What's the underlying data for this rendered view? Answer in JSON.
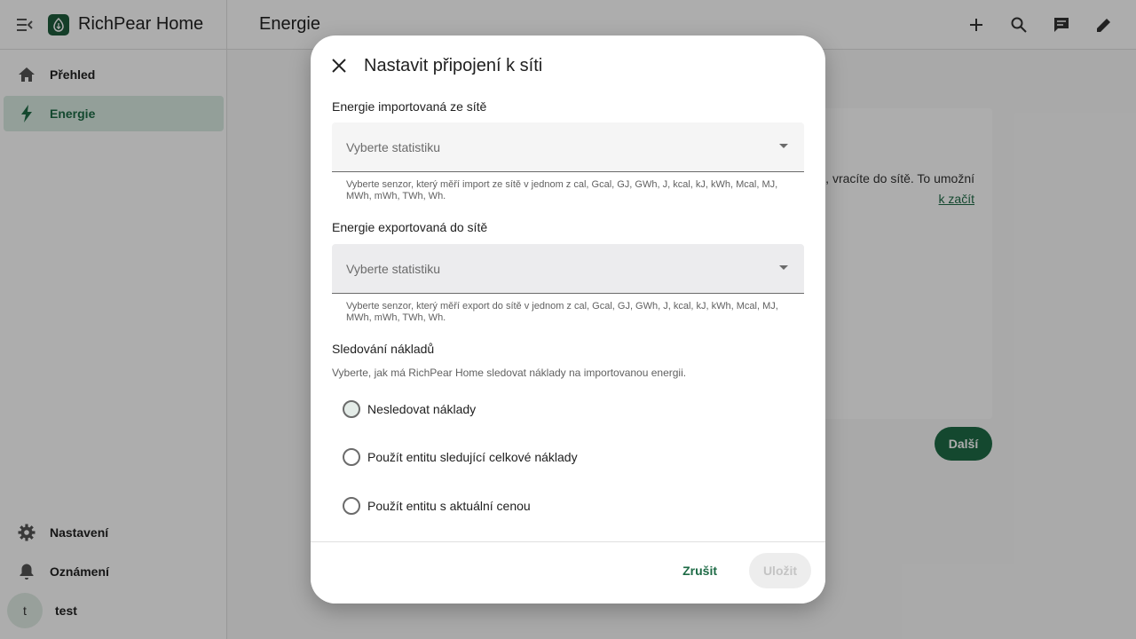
{
  "app": {
    "title": "RichPear Home"
  },
  "sidebar": {
    "items": [
      {
        "label": "Přehled",
        "icon": "home-icon"
      },
      {
        "label": "Energie",
        "icon": "lightning-icon"
      }
    ],
    "bottom_items": [
      {
        "label": "Nastavení",
        "icon": "gear-icon"
      },
      {
        "label": "Oznámení",
        "icon": "bell-icon"
      }
    ],
    "user": {
      "initial": "t",
      "name": "test"
    }
  },
  "header": {
    "title": "Energie"
  },
  "background_card": {
    "text_line1": "e, vracíte do sítě. To umožní",
    "link_text": "k začít",
    "next_label": "Další"
  },
  "dialog": {
    "title": "Nastavit připojení k síti",
    "import": {
      "label": "Energie importovaná ze sítě",
      "placeholder": "Vyberte statistiku",
      "helper": "Vyberte senzor, který měří import ze sítě v jednom z cal, Gcal, GJ, GWh, J, kcal, kJ, kWh, Mcal, MJ, MWh, mWh, TWh, Wh."
    },
    "export": {
      "label": "Energie exportovaná do sítě",
      "placeholder": "Vyberte statistiku",
      "helper": "Vyberte senzor, který měří export do sítě v jednom z cal, Gcal, GJ, GWh, J, kcal, kJ, kWh, Mcal, MJ, MWh, mWh, TWh, Wh."
    },
    "cost": {
      "label": "Sledování nákladů",
      "description": "Vyberte, jak má RichPear Home sledovat náklady na importovanou energii.",
      "options": [
        "Nesledovat náklady",
        "Použít entitu sledující celkové náklady",
        "Použít entitu s aktuální cenou"
      ]
    },
    "cancel_label": "Zrušit",
    "save_label": "Uložit"
  },
  "colors": {
    "accent": "#1e6b46",
    "active_nav_bg": "#d9ebe2"
  }
}
